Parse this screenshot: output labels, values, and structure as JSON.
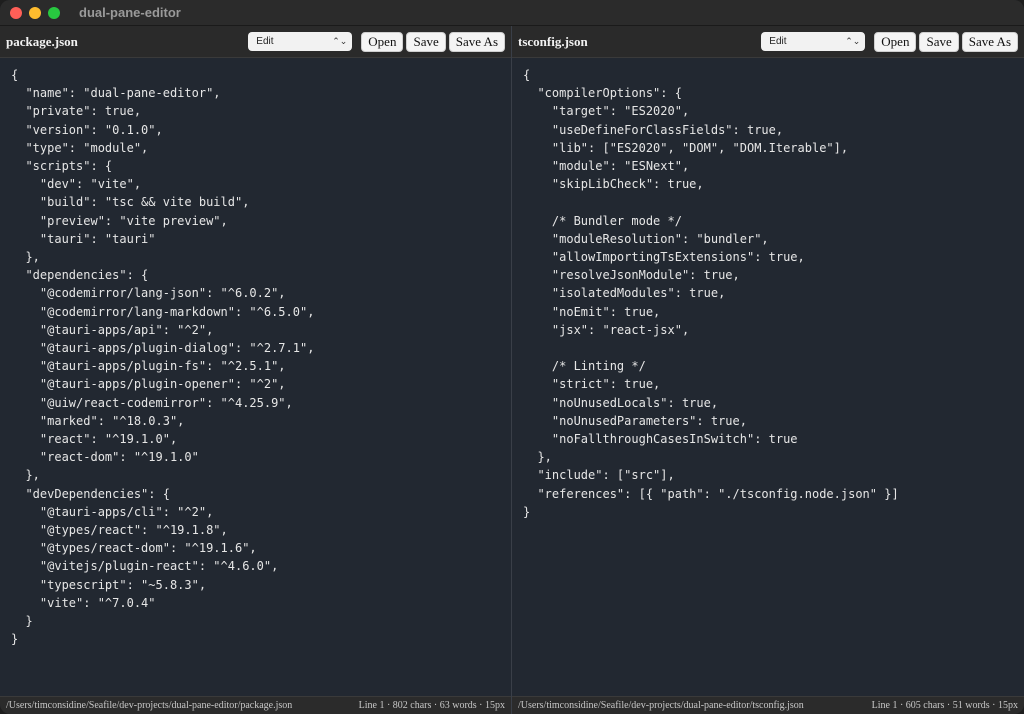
{
  "window": {
    "title": "dual-pane-editor"
  },
  "left": {
    "filename": "package.json",
    "mode": "Edit",
    "open_label": "Open",
    "save_label": "Save",
    "saveas_label": "Save As",
    "lines": [
      "{",
      "  \"name\": \"dual-pane-editor\",",
      "  \"private\": true,",
      "  \"version\": \"0.1.0\",",
      "  \"type\": \"module\",",
      "  \"scripts\": {",
      "    \"dev\": \"vite\",",
      "    \"build\": \"tsc && vite build\",",
      "    \"preview\": \"vite preview\",",
      "    \"tauri\": \"tauri\"",
      "  },",
      "  \"dependencies\": {",
      "    \"@codemirror/lang-json\": \"^6.0.2\",",
      "    \"@codemirror/lang-markdown\": \"^6.5.0\",",
      "    \"@tauri-apps/api\": \"^2\",",
      "    \"@tauri-apps/plugin-dialog\": \"^2.7.1\",",
      "    \"@tauri-apps/plugin-fs\": \"^2.5.1\",",
      "    \"@tauri-apps/plugin-opener\": \"^2\",",
      "    \"@uiw/react-codemirror\": \"^4.25.9\",",
      "    \"marked\": \"^18.0.3\",",
      "    \"react\": \"^19.1.0\",",
      "    \"react-dom\": \"^19.1.0\"",
      "  },",
      "  \"devDependencies\": {",
      "    \"@tauri-apps/cli\": \"^2\",",
      "    \"@types/react\": \"^19.1.8\",",
      "    \"@types/react-dom\": \"^19.1.6\",",
      "    \"@vitejs/plugin-react\": \"^4.6.0\",",
      "    \"typescript\": \"~5.8.3\",",
      "    \"vite\": \"^7.0.4\"",
      "  }",
      "}"
    ],
    "path": "/Users/timconsidine/Seafile/dev-projects/dual-pane-editor/package.json",
    "stats": "Line 1 · 802 chars · 63 words · 15px"
  },
  "right": {
    "filename": "tsconfig.json",
    "mode": "Edit",
    "open_label": "Open",
    "save_label": "Save",
    "saveas_label": "Save As",
    "lines": [
      "{",
      "  \"compilerOptions\": {",
      "    \"target\": \"ES2020\",",
      "    \"useDefineForClassFields\": true,",
      "    \"lib\": [\"ES2020\", \"DOM\", \"DOM.Iterable\"],",
      "    \"module\": \"ESNext\",",
      "    \"skipLibCheck\": true,",
      "",
      "    /* Bundler mode */",
      "    \"moduleResolution\": \"bundler\",",
      "    \"allowImportingTsExtensions\": true,",
      "    \"resolveJsonModule\": true,",
      "    \"isolatedModules\": true,",
      "    \"noEmit\": true,",
      "    \"jsx\": \"react-jsx\",",
      "",
      "    /* Linting */",
      "    \"strict\": true,",
      "    \"noUnusedLocals\": true,",
      "    \"noUnusedParameters\": true,",
      "    \"noFallthroughCasesInSwitch\": true",
      "  },",
      "  \"include\": [\"src\"],",
      "  \"references\": [{ \"path\": \"./tsconfig.node.json\" }]",
      "}"
    ],
    "path": "/Users/timconsidine/Seafile/dev-projects/dual-pane-editor/tsconfig.json",
    "stats": "Line 1 · 605 chars · 51 words · 15px"
  }
}
